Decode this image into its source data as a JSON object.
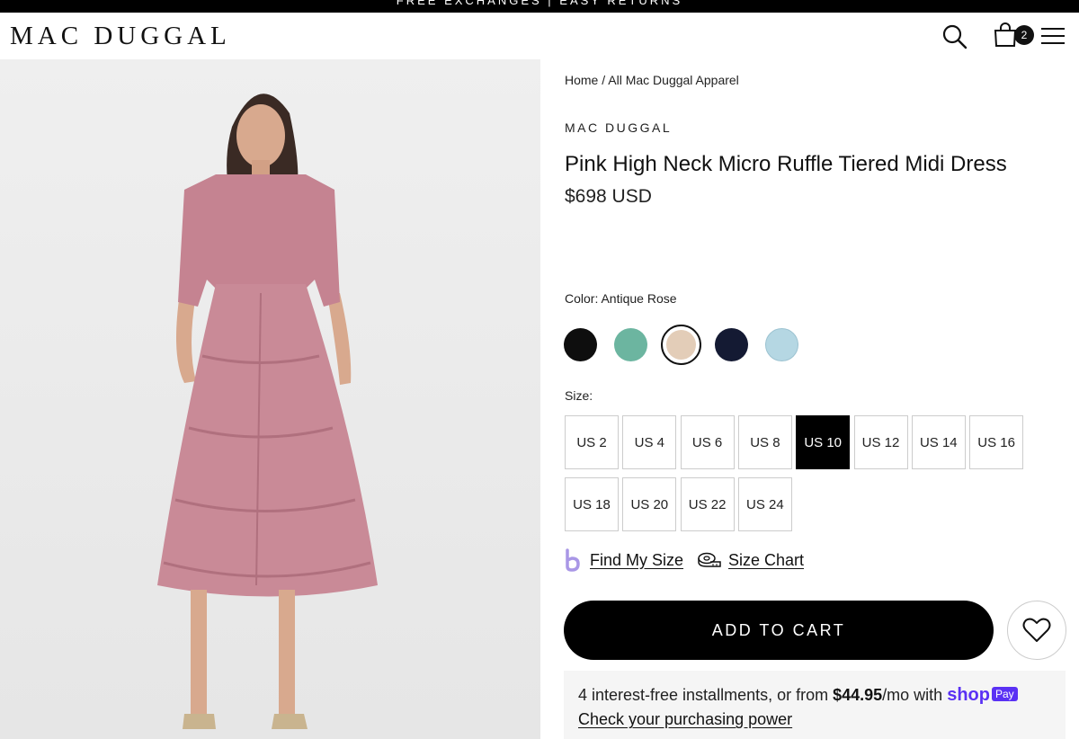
{
  "promo": {
    "text": "FREE EXCHANGES | EASY RETURNS"
  },
  "header": {
    "logo": "MAC DUGGAL",
    "cart_count": "2"
  },
  "breadcrumb": {
    "home": "Home",
    "separator": " / ",
    "current": "All Mac Duggal Apparel"
  },
  "product": {
    "brand": "MAC DUGGAL",
    "title": "Pink High Neck Micro Ruffle Tiered Midi Dress",
    "price": "$698 USD",
    "image_icon": "dress-photo"
  },
  "color": {
    "label": "Color: Antique Rose",
    "swatches": [
      {
        "name": "black",
        "hex": "#0e0e0e"
      },
      {
        "name": "teal",
        "hex": "#6cb5a0"
      },
      {
        "name": "antique-rose",
        "hex": "#e3cdb8",
        "selected": true
      },
      {
        "name": "navy",
        "hex": "#141a33"
      },
      {
        "name": "light-blue",
        "hex": "#b5d7e3"
      }
    ]
  },
  "size": {
    "label": "Size:",
    "options": [
      "US 2",
      "US 4",
      "US 6",
      "US 8",
      "US 10",
      "US 12",
      "US 14",
      "US 16",
      "US 18",
      "US 20",
      "US 22",
      "US 24"
    ],
    "selected": "US 10"
  },
  "links": {
    "find_my_size": "Find My Size",
    "size_chart": "Size Chart"
  },
  "actions": {
    "add_to_cart": "ADD TO CART"
  },
  "installments": {
    "prefix": "4 interest-free installments, or from ",
    "amount": "$44.95",
    "suffix": "/mo with ",
    "provider": "shop",
    "badge": "Pay",
    "link": "Check your purchasing power"
  },
  "colors": {
    "accent": "#000000",
    "shop_pay": "#5a31f4",
    "dress": "#c98a97"
  }
}
